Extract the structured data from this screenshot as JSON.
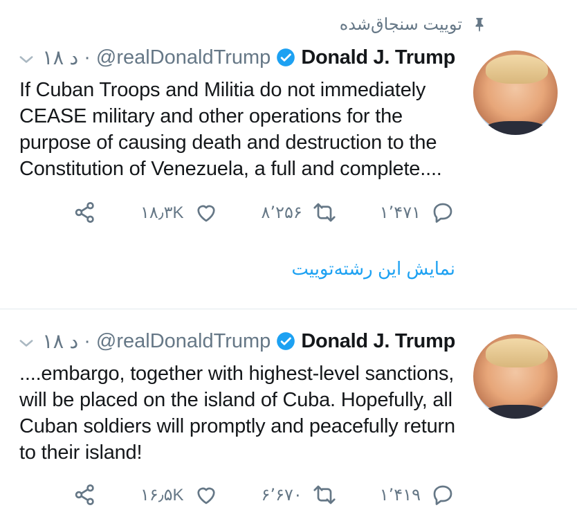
{
  "pinned_label": "توییت سنجاق‌شده",
  "tweets": [
    {
      "author_name": "Donald J. Trump",
      "handle": "@realDonaldTrump",
      "separator": "·",
      "time": "۱۸ د",
      "text": "If Cuban Troops and Militia do not immediately CEASE military and other operations for the purpose of causing death and destruction to the Constitution of Venezuela, a full and complete....",
      "likes": "۱۸٫۳K",
      "retweets": "۸٬۲۵۶",
      "replies": "۱٬۴۷۱",
      "thread_link": "نمایش این رشته‌توییت"
    },
    {
      "author_name": "Donald J. Trump",
      "handle": "@realDonaldTrump",
      "separator": "·",
      "time": "۱۸ د",
      "text": "....embargo, together with highest-level sanctions, will be placed on the island of Cuba. Hopefully, all Cuban soldiers will promptly and peacefully return to their island!",
      "likes": "۱۶٫۵K",
      "retweets": "۶٬۶۷۰",
      "replies": "۱٬۴۱۹"
    }
  ],
  "colors": {
    "accent": "#1da1f2",
    "muted": "#657786",
    "text": "#14171a",
    "divider": "#e1e8ed"
  },
  "icons": [
    "pin-icon",
    "caret-down-icon",
    "verified-icon",
    "share-icon",
    "heart-icon",
    "retweet-icon",
    "reply-icon"
  ]
}
